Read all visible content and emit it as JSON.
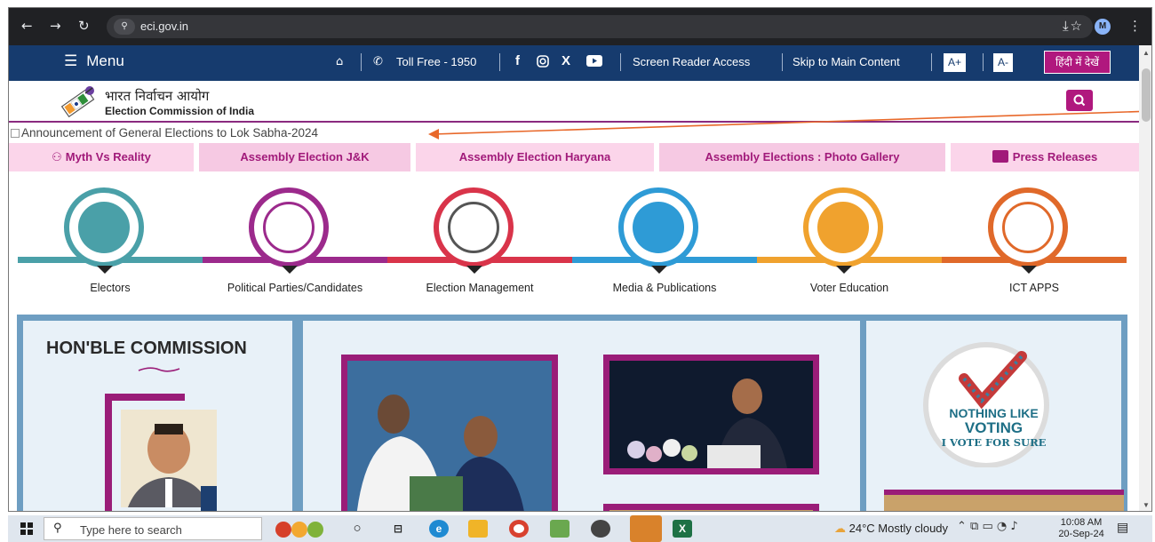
{
  "browser": {
    "url": "eci.gov.in",
    "profile_initial": "M",
    "icons": [
      "back-icon",
      "forward-icon",
      "reload-icon",
      "site-info-icon",
      "star-icon",
      "download-icon",
      "more-icon"
    ]
  },
  "topbar": {
    "menu_label": "Menu",
    "toll_free": "Toll Free - 1950",
    "screen_reader": "Screen Reader Access",
    "skip_main": "Skip to Main Content",
    "font_increase": "A+",
    "font_decrease": "A-",
    "hindi": "हिंदी में देखें",
    "social": [
      "facebook-icon",
      "instagram-icon",
      "x-icon",
      "youtube-icon"
    ]
  },
  "header": {
    "brand_hindi": "भारत निर्वाचन आयोग",
    "brand_english": "Election Commission of India"
  },
  "announcement": "Announcement of General Elections to Lok Sabha-2024",
  "quick_tabs": [
    {
      "label": "Myth Vs Reality"
    },
    {
      "label": "Assembly Election J&K"
    },
    {
      "label": "Assembly Election Haryana"
    },
    {
      "label": "Assembly Elections : Photo Gallery"
    },
    {
      "label": "Press Releases"
    }
  ],
  "categories": [
    {
      "label": "Electors",
      "color": "#4aa0a8"
    },
    {
      "label": "Political Parties/Candidates",
      "color": "#9c2a8c"
    },
    {
      "label": "Election Management",
      "color": "#d9344a"
    },
    {
      "label": "Media & Publications",
      "color": "#2e9bd6"
    },
    {
      "label": "Voter Education",
      "color": "#f0a22e"
    },
    {
      "label": "ICT APPS",
      "color": "#e0692a"
    }
  ],
  "commission": {
    "title": "HON'BLE COMMISSION"
  },
  "voting_logo": {
    "line1": "NOTHING LIKE",
    "line2": "VOTING",
    "line3": "I VOTE FOR SURE"
  },
  "taskbar": {
    "search_placeholder": "Type here to search",
    "weather": "24°C  Mostly cloudy",
    "time": "10:08 AM",
    "date": "20-Sep-24"
  }
}
